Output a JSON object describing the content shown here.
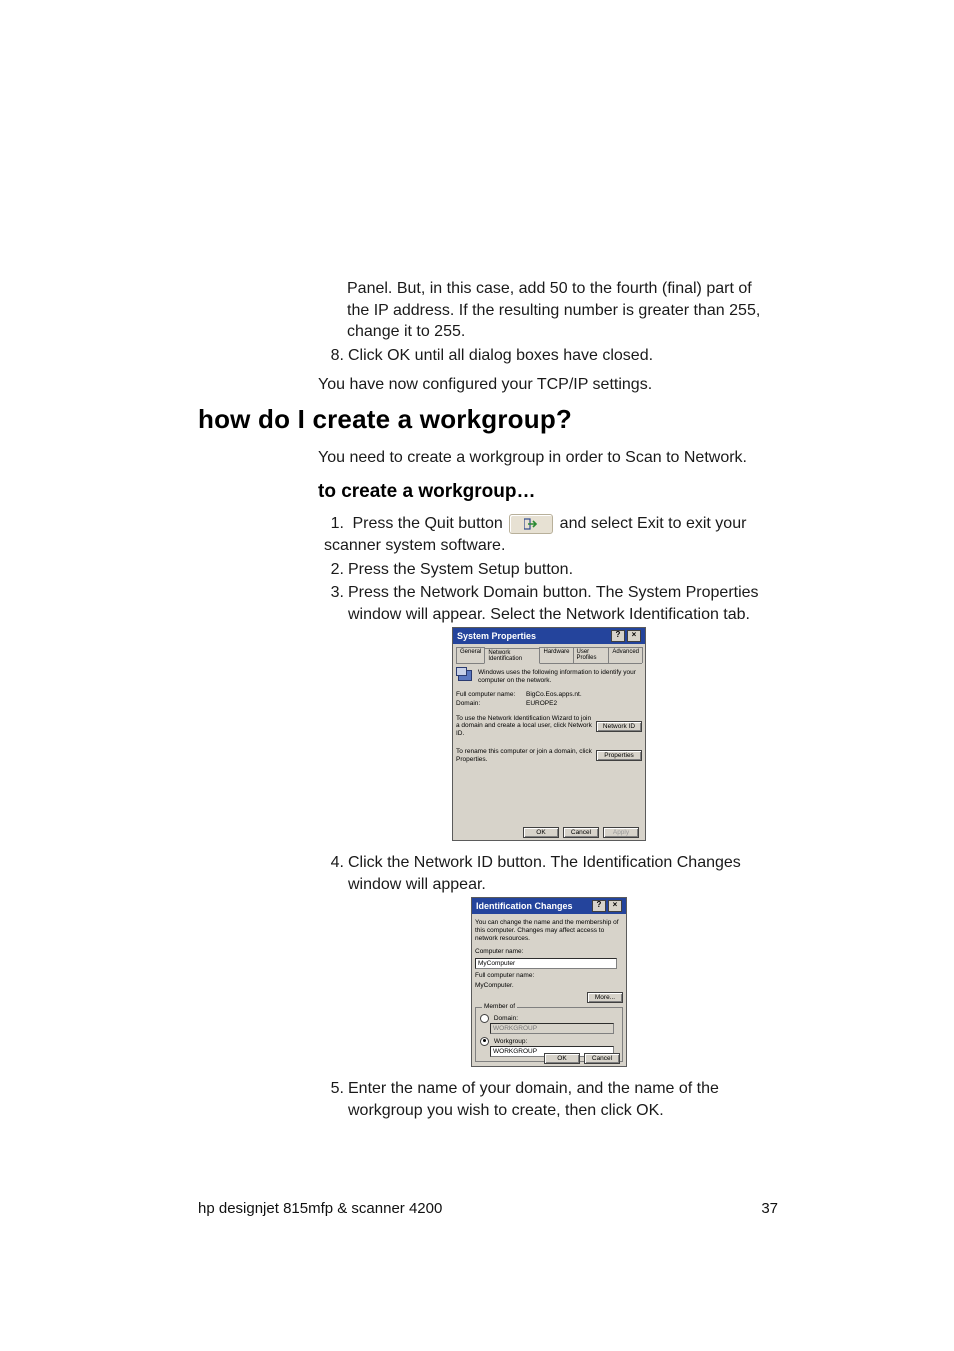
{
  "continuation": {
    "para": "Panel. But, in this case, add 50 to the fourth (final) part of the IP address. If the resulting number is greater than 255, change it to 255."
  },
  "step8": {
    "num": "8.",
    "text": "Click OK until all dialog boxes have closed."
  },
  "tcpip_done": "You have now configured your TCP/IP settings.",
  "heading": "how do I create a workgroup?",
  "intro": "You need to create a workgroup in order to Scan to Network.",
  "subheading": "to create a workgroup…",
  "step1": {
    "num": "1.",
    "pre": "Press the Quit button",
    "post": " and select Exit to exit your scanner system software."
  },
  "step2": {
    "num": "2.",
    "text": "Press the System Setup button."
  },
  "step3": {
    "num": "3.",
    "text": "Press the Network Domain button. The System Properties window will appear. Select the Network Identification tab."
  },
  "step4": {
    "num": "4.",
    "text": "Click the Network ID button. The Identification Changes window will appear."
  },
  "step5": {
    "num": "5.",
    "text": "Enter the name of your domain, and the name of the workgroup you wish to create, then click OK."
  },
  "sysprops": {
    "title": "System Properties",
    "tabs": [
      "General",
      "Network Identification",
      "Hardware",
      "User Profiles",
      "Advanced"
    ],
    "infotext": "Windows uses the following information to identify your computer on the network.",
    "full_label": "Full computer name:",
    "full_value": "BigCo.Eos.apps.nt.",
    "domain_label": "Domain:",
    "domain_value": "EUROPE2",
    "wizard_text": "To use the Network Identification Wizard to join a domain and create a local user, click Network ID.",
    "rename_text": "To rename this computer or join a domain, click Properties.",
    "btn_networkid": "Network ID",
    "btn_properties": "Properties",
    "btn_ok": "OK",
    "btn_cancel": "Cancel",
    "btn_apply": "Apply"
  },
  "idchanges": {
    "title": "Identification Changes",
    "desc": "You can change the name and the membership of this computer. Changes may affect access to network resources.",
    "comp_label": "Computer name:",
    "comp_value": "MyComputer",
    "full_label": "Full computer name:",
    "full_value": "MyComputer.",
    "btn_more": "More...",
    "member_label": "Member of",
    "radio_domain": "Domain:",
    "domain_value": "WORKGROUP",
    "radio_workgroup": "Workgroup:",
    "workgroup_value": "WORKGROUP",
    "btn_ok": "OK",
    "btn_cancel": "Cancel"
  },
  "footer": {
    "left": "hp designjet 815mfp & scanner 4200",
    "page": "37"
  }
}
